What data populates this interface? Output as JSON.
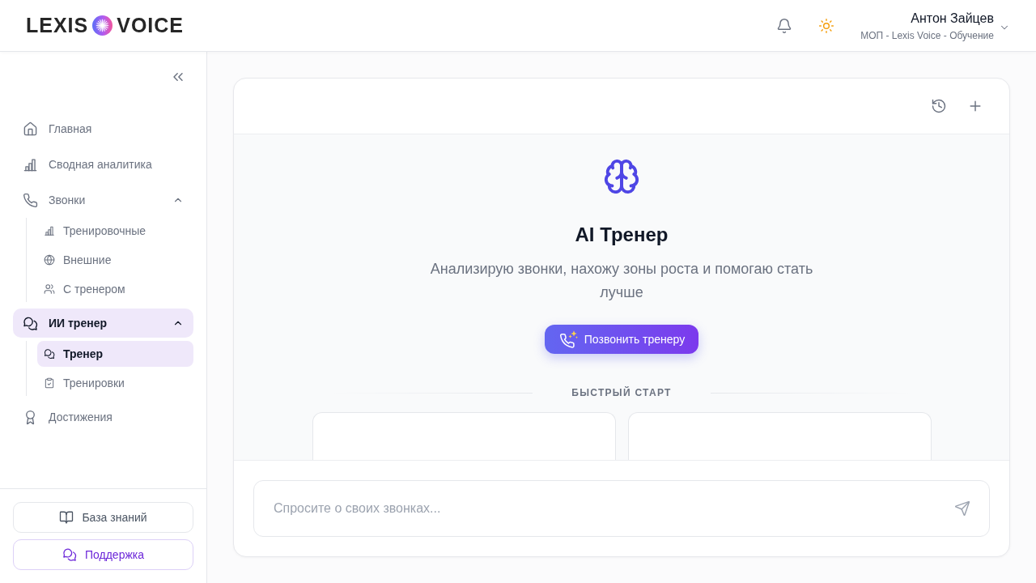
{
  "header": {
    "logo": {
      "word_left": "LEXIS",
      "word_right": "VOICE"
    },
    "user": {
      "name": "Антон Зайцев",
      "role": "МОП - Lexis Voice - Обучение"
    }
  },
  "sidebar": {
    "items": [
      {
        "label": "Главная",
        "selected": false
      },
      {
        "label": "Сводная аналитика",
        "selected": false
      },
      {
        "label": "Звонки",
        "selected": false,
        "expanded": true,
        "children": [
          {
            "label": "Тренировочные",
            "selected": false
          },
          {
            "label": "Внешние",
            "selected": false
          },
          {
            "label": "С тренером",
            "selected": false
          }
        ]
      },
      {
        "label": "ИИ тренер",
        "selected": true,
        "expanded": true,
        "children": [
          {
            "label": "Тренер",
            "selected": true
          },
          {
            "label": "Тренировки",
            "selected": false
          }
        ]
      },
      {
        "label": "Достижения",
        "selected": false
      }
    ],
    "footer_buttons": [
      {
        "label": "База знаний",
        "kind": "plain"
      },
      {
        "label": "Поддержка",
        "kind": "accent"
      }
    ]
  },
  "assistant": {
    "title": "AI Тренер",
    "subtitle": "Анализирую звонки, нахожу зоны роста и помогаю стать лучше",
    "call_button": "Позвонить тренеру",
    "quick_start_label": "БЫСТРЫЙ СТАРТ",
    "composer": {
      "placeholder": "Спросите о своих звонках..."
    }
  }
}
